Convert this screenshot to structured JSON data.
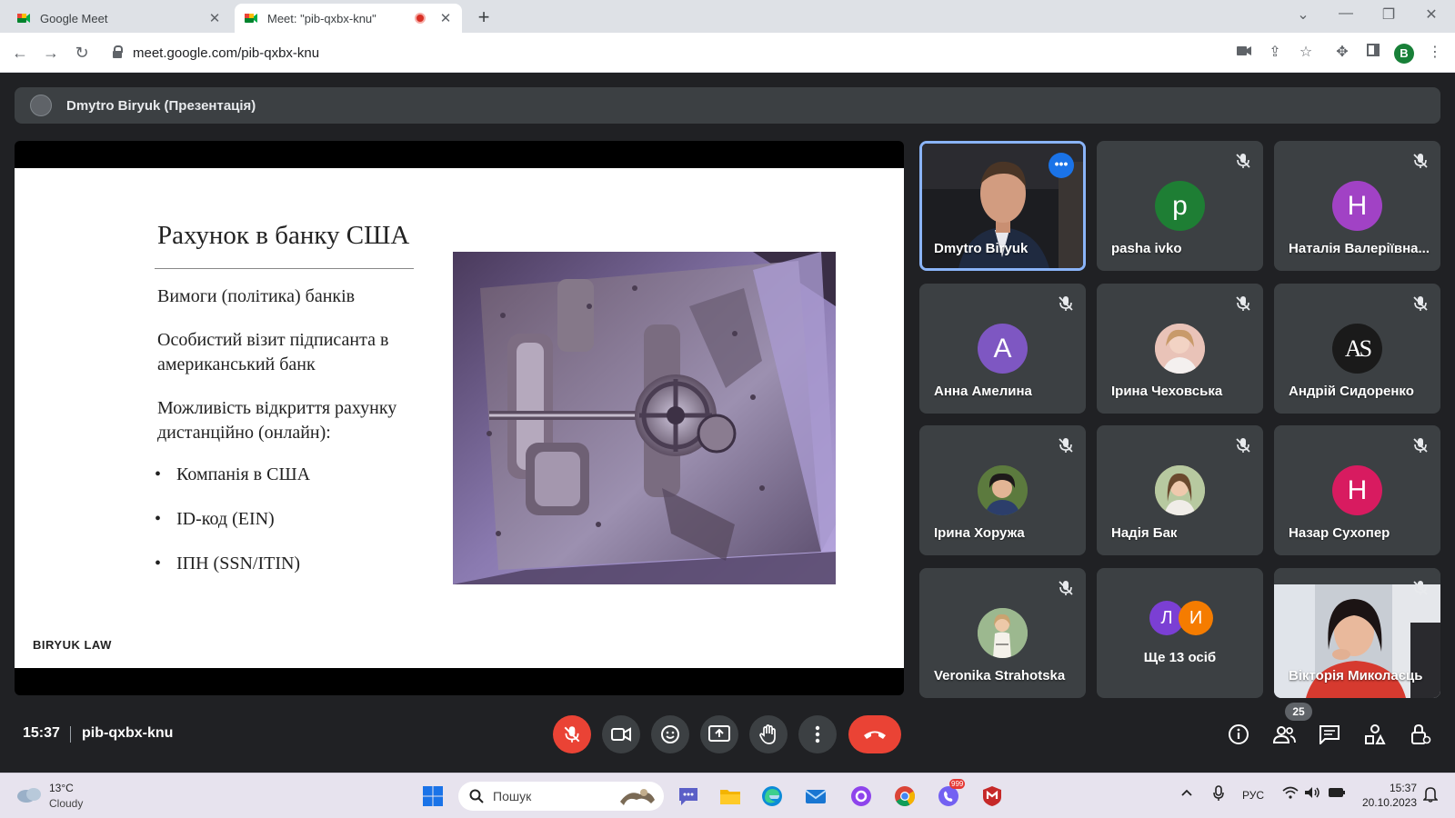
{
  "browser": {
    "tabs": [
      {
        "title": "Google Meet",
        "active": false
      },
      {
        "title": "Meet: \"pib-qxbx-knu\"",
        "active": true,
        "recording": true
      }
    ],
    "url": "meet.google.com/pib-qxbx-knu",
    "profile_initial": "B"
  },
  "presenter_bar": {
    "name": "Dmytro Biryuk (Презентація)"
  },
  "slide": {
    "title": "Рахунок в банку США",
    "paragraphs": [
      "Вимоги (політика) банків",
      "Особистий візит підписанта в американський банк",
      "Можливість відкриття рахунку дистанційно (онлайн):"
    ],
    "bullets": [
      "Компанія в США",
      "ID-код (EIN)",
      "ІПН (SSN/ITIN)"
    ],
    "brand": "BIRYUK LAW",
    "image": "bank-vault-door"
  },
  "participants": [
    {
      "name": "Dmytro Biryuk",
      "video": true,
      "speaking": true
    },
    {
      "name": "pasha ivko",
      "initial": "p",
      "color": "#1e7e34",
      "muted": true
    },
    {
      "name": "Наталія Валеріївна...",
      "initial": "Н",
      "color": "#a142c5",
      "muted": true
    },
    {
      "name": "Анна Амелина",
      "initial": "А",
      "color": "#7e57c2",
      "muted": true
    },
    {
      "name": "Ірина Чеховська",
      "photo": true,
      "color": "#d9a7a0",
      "muted": true
    },
    {
      "name": "Андрій Сидоренко",
      "initial": "AS",
      "color": "#1a1a1a",
      "muted": true
    },
    {
      "name": "Ірина Хоружа",
      "photo": true,
      "color": "#4a5d3a",
      "muted": true
    },
    {
      "name": "Надія Бак",
      "photo": true,
      "color": "#c9b48a",
      "muted": true
    },
    {
      "name": "Назар Сухопер",
      "initial": "Н",
      "color": "#d81b60",
      "muted": true
    },
    {
      "name": "Veronika Strahotska",
      "photo": true,
      "color": "#8fa98a",
      "muted": true
    },
    {
      "name": "Ще 13 осіб",
      "others": [
        {
          "initial": "Л",
          "color": "#7b3fd4"
        },
        {
          "initial": "И",
          "color": "#f57c00"
        }
      ]
    },
    {
      "name": "Вікторія Миколаєць",
      "video": true,
      "muted": true
    }
  ],
  "controls": {
    "time": "15:37",
    "meeting_code": "pib-qxbx-knu",
    "participant_count": "25"
  },
  "taskbar": {
    "temperature": "13°C",
    "weather": "Cloudy",
    "search_placeholder": "Пошук",
    "viber_badge": "999",
    "language": "РУС",
    "time": "15:37",
    "date": "20.10.2023"
  }
}
